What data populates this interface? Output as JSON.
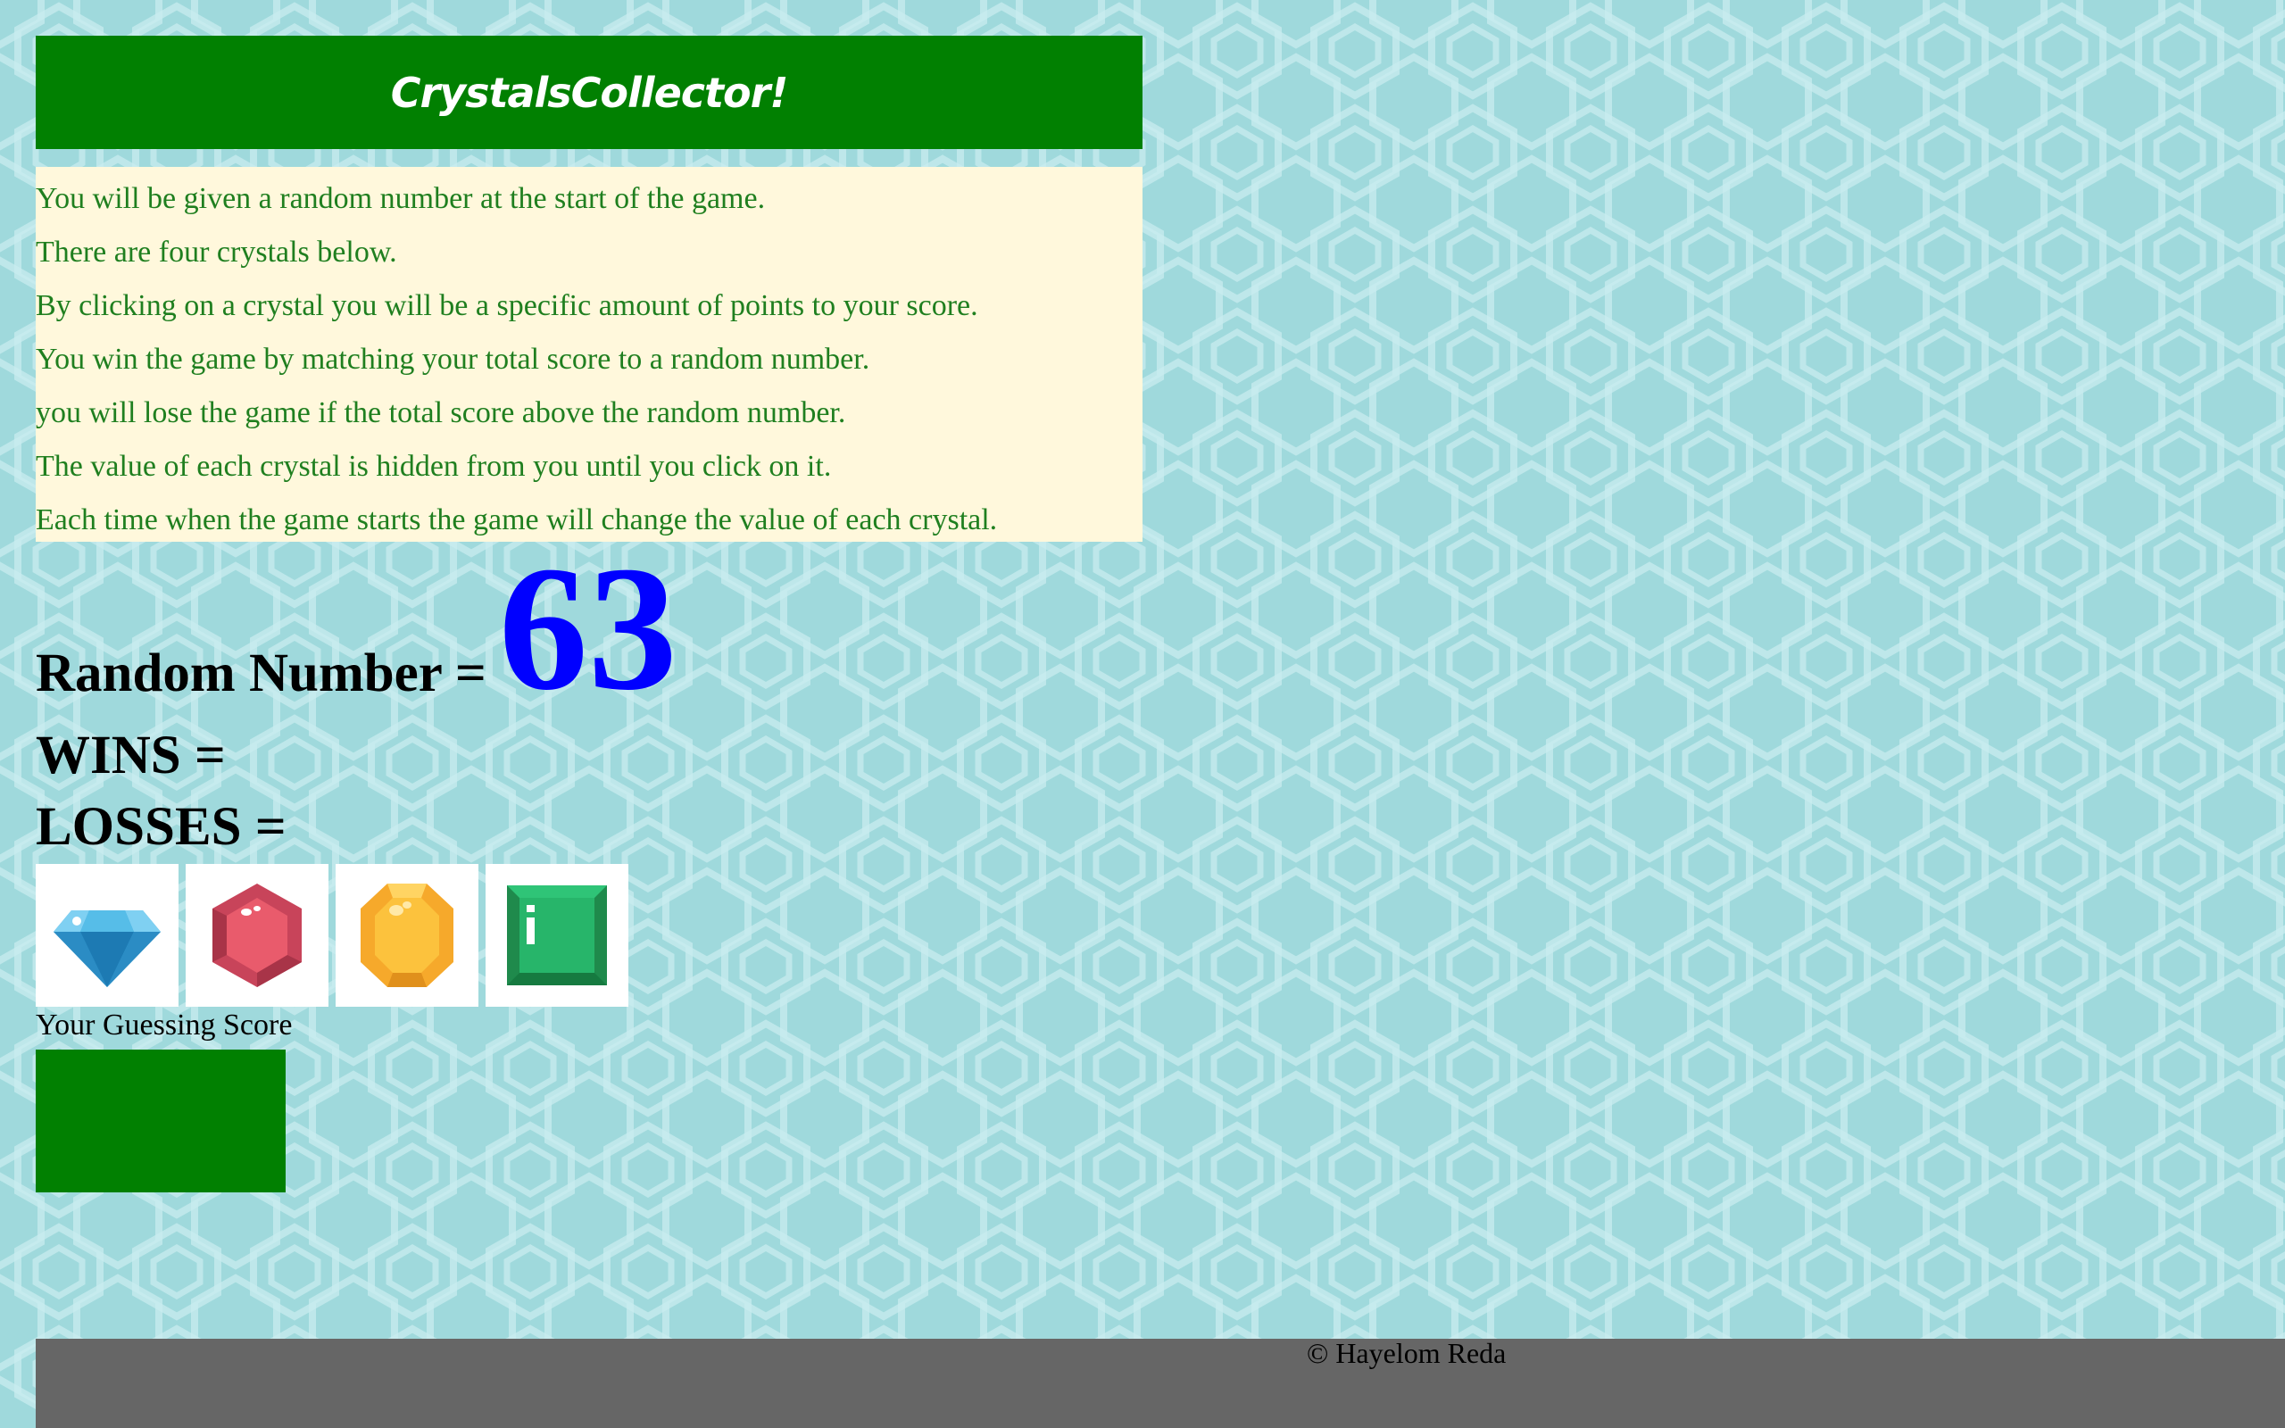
{
  "header": {
    "title": "CrystalsCollector!"
  },
  "instructions": [
    "You will be given a random number at the start of the game.",
    "There are four crystals below.",
    "By clicking on a crystal you will be a specific amount of points to your score.",
    "You win the game by matching your total score to a random number.",
    "you will lose the game if the total score above the random number.",
    "The value of each crystal is hidden from you until you click on it.",
    "Each time when the game starts the game will change the value of each crystal."
  ],
  "stats": {
    "random_label": "Random Number =",
    "random_value": "63",
    "wins_label": "WINS =",
    "wins_value": "",
    "losses_label": "LOSSES =",
    "losses_value": ""
  },
  "crystals": [
    {
      "icon": "blue-diamond-icon"
    },
    {
      "icon": "red-hexagon-gem-icon"
    },
    {
      "icon": "yellow-octagon-gem-icon"
    },
    {
      "icon": "green-square-gem-icon"
    }
  ],
  "score": {
    "label": "Your Guessing Score",
    "value": ""
  },
  "footer": {
    "text": "© Hayelom Reda"
  },
  "colors": {
    "header_bg": "#018001",
    "instructions_bg": "#fff8dc",
    "instructions_text": "#1f7f1f",
    "random_value": "#0000ff",
    "score_bg": "#018001",
    "footer_bg": "#666666",
    "page_bg": "#9fd9dc"
  }
}
